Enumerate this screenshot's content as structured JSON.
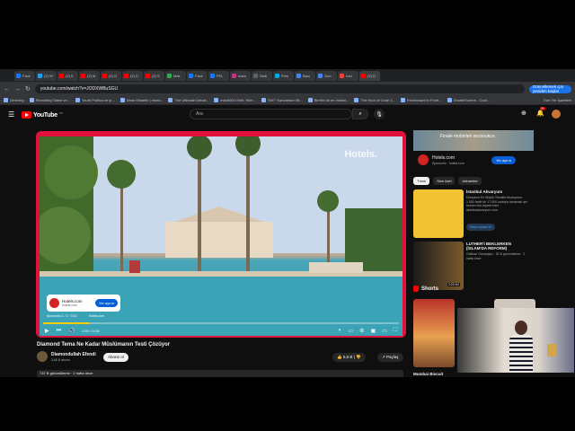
{
  "browser": {
    "tabs": [
      "Face",
      "(2) W",
      "(2) K",
      "(2) M",
      "(2) G",
      "(2) D",
      "(2) S",
      "Mak",
      "Face",
      "FEL",
      "Insta",
      "Sedi",
      "Prim",
      "Bazı",
      "Goo",
      "rum",
      "(2) D"
    ],
    "url": "youtube.com/watch?v=JODXWBuSGU",
    "update_button": "Güncellemek için yeniden başlat",
    "bookmarks": [
      "Ordering",
      "Recruiting Talent ve...",
      "Youth Politics ve ip...",
      "Dean Minarlle | meav...",
      "The Ultimate Debat...",
      "mac6000-Shirt, Hilm...",
      "\"Bil?\" Kanvamanı Bi...",
      "Birebir da en İmekki...",
      "The Hour of Code 2...",
      "Feldenwant in Front...",
      "DoubleScreen - Cool..."
    ],
    "other_bookmarks": "Tüm Yer İşaretleri"
  },
  "youtube": {
    "logo_text": "YouTube",
    "country": "TR",
    "search_placeholder": "Ara",
    "notification_count": "9+"
  },
  "player": {
    "watermark": "Hotels.",
    "ad_card": {
      "name": "Hotels.com",
      "domain": "hotels.com",
      "button": "Yer ayırın"
    },
    "ad_meta": "Sponsorlu 1 / 2 · 0:12",
    "ad_url": "hotels.com",
    "time": "0:02 / 0:15",
    "progress": 0.13,
    "accent_color": "#e0123c"
  },
  "video": {
    "title": "Diamond Tema Ne Kadar Müslümanın Testi Çözüyor",
    "channel": "Diamondullah Efendi",
    "subscribers": "3,65 B abone",
    "subscribe_label": "Abone ol",
    "likes": "5,6 B",
    "share_label": "Paylaş",
    "views": "737 B görüntüleme · 2 hafta önce"
  },
  "sidebar": {
    "ad_headline": "Finale mobinleri sezonukce.",
    "sponsor": {
      "name": "Hotels.com",
      "sub": "Sponsorlu · hotels.com",
      "button": "Yer ayırın"
    },
    "chips": [
      "Tümü",
      "Size özel",
      "İzlenenler"
    ],
    "recommendations": [
      {
        "title": "İstanbul Akvaryum",
        "desc": "Dünyanın En Büyük Tematik Akvaryumu. 1.500 farklı tür 17.000 canlıyla tanışmak için hemen bizi ziyaret edin · istanbulakvaryum.com",
        "button": "Siteyi ziyaret et"
      },
      {
        "title": "LUTHER'İ BEKLERKEN (İSLAM'DA REFORM)",
        "desc": "Gökhan Gündoğdu · 51 B görüntüleme · 2 hafta önce",
        "duration": "2:22:54"
      }
    ],
    "shorts_label": "Shorts",
    "short_title": "Mumbai Biscuit"
  }
}
